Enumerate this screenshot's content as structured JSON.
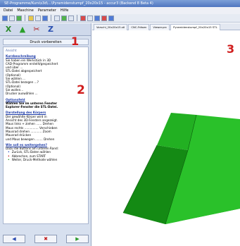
{
  "window": {
    "title": "SE-Programme/Kurs\\s3d\\...\\Pyramidenstumpf_20x20x15 - accur3 (Backend 8 Beta 4)"
  },
  "menu": {
    "items": [
      "Datei",
      "Maschine",
      "Parameter",
      "Hilfe"
    ]
  },
  "left_tabs": {
    "tab1_label": "X",
    "tab2_label": "▲",
    "tab3_label": "✂",
    "tab4_label": "Z"
  },
  "panel": {
    "title": "Druck vorbereiten",
    "label": "Ansicht",
    "sections": [
      {
        "heading": "Kurzbeschreibung",
        "lines": [
          "Sie haben ein Werkstück in 3D",
          "CAD-Programm erstellt/gespeichert",
          "und über ...",
          "STL-Datei abgespeichert",
          "(Optional)",
          "Sie wählen ...",
          "STL-Datei bezogen ...?",
          "(Optional)",
          "Sie wollen...",
          "Drucker auswählen ..."
        ]
      },
      {
        "heading": "Optionsfeld",
        "lines": [
          "Wählen Sie im unteren Fenster",
          "Explorer-Fenster die STL-Datei."
        ]
      },
      {
        "heading": "Darstellung des Körpers",
        "lines": [
          "Der gewählte Körper wird in",
          "Ansicht des 3D-Fensters angezeigt.",
          "Maus links + ziehen ...... Drehen",
          "Maus rechts ............... Verschieben",
          "Mausrad drehen ............ Zoom",
          "Mausrad drücken",
          "  und Maus bewegen ........ Drehen"
        ]
      },
      {
        "heading": "Wie soll es weitergehen?",
        "lines": [
          "Dazu die Buttons am unteren Rand:"
        ],
        "bullets": [
          "Zurück, STL-Daten wählen",
          "Abbrechen, zum START",
          "Weiter, Druck-Methode wählen"
        ]
      }
    ]
  },
  "bottom_buttons": {
    "back_label": "◀",
    "cancel_label": "✖",
    "next_label": "▶"
  },
  "doc_tabs": [
    "Vorschl_20x20x15.stl",
    "CNC-Fräsen",
    "Viewer.prc",
    "Pyramidenstumpf_20x20x15 STL"
  ],
  "annotations": {
    "one": "1",
    "two": "2",
    "three": "3"
  },
  "colors": {
    "accent_red": "#d01e1e",
    "shape_green": "#1aa11a"
  }
}
